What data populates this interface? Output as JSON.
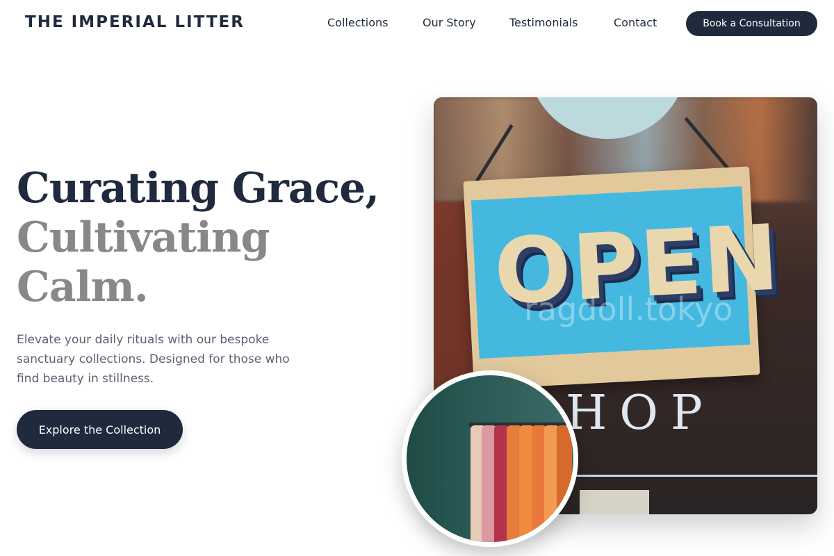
{
  "header": {
    "brand": "THE IMPERIAL LITTER",
    "nav": [
      "Collections",
      "Our Story",
      "Testimonials",
      "Contact"
    ],
    "cta_label": "Book a Consultation"
  },
  "hero": {
    "headline_line1": "Curating Grace,",
    "headline_line2": "Cultivating",
    "headline_line3": "Calm.",
    "lede": "Elevate your daily rituals with our bespoke sanctuary collections. Designed for those who find beauty in stillness.",
    "cta_label": "Explore the Collection"
  },
  "images": {
    "main_sign_text": "OPEN",
    "main_shop_text": "HOP",
    "watermark": "ragdoll.tokyo",
    "inset_icon": "clothing-rack-photo"
  },
  "colors": {
    "primary": "#1f2a3d",
    "muted_heading": "#8b8789",
    "body_text": "#5a6272",
    "background": "#ffffff"
  }
}
